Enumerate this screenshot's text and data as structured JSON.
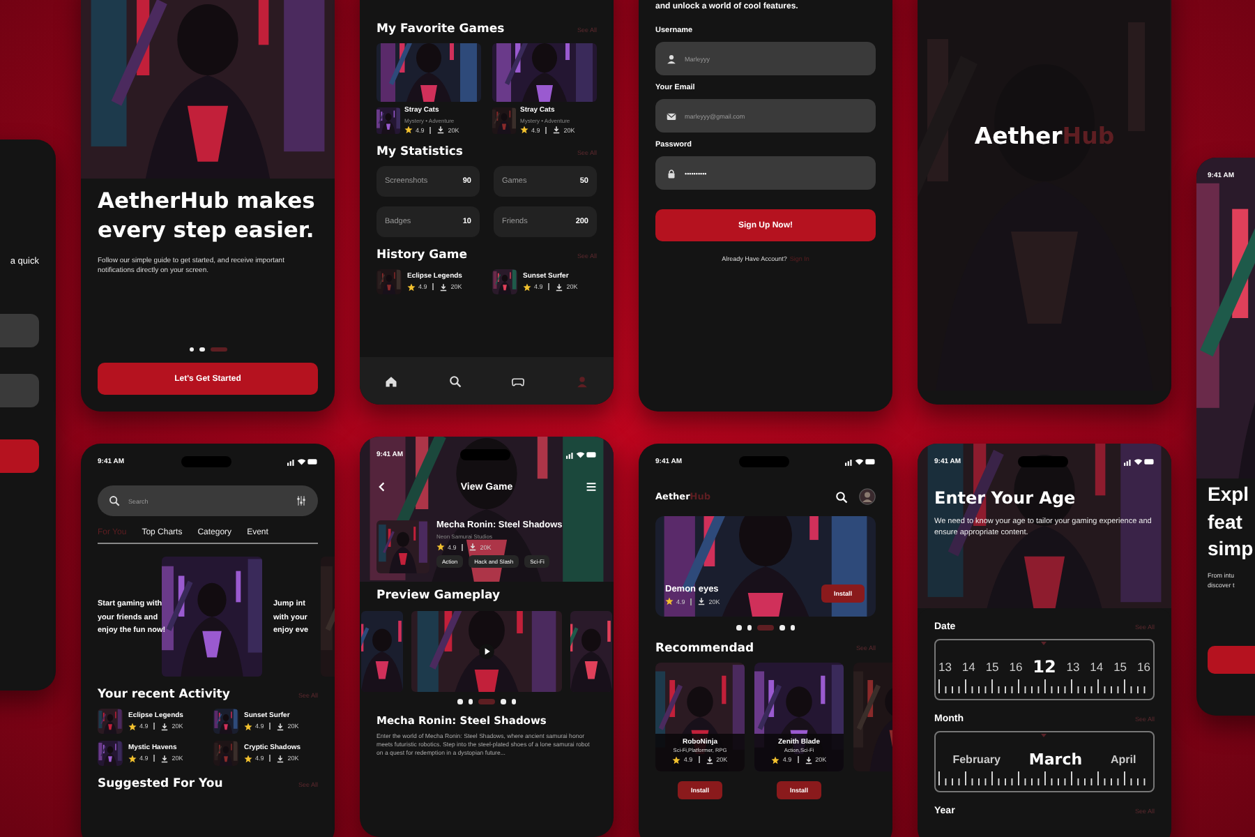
{
  "left_screen": {
    "heading": "a quick"
  },
  "onboarding": {
    "title": "AetherHub makes every step easier.",
    "body": "Follow our simple guide to get started, and receive important notifications directly on your screen.",
    "dots": [
      {
        "selected": false
      },
      {
        "selected": false
      },
      {
        "selected": true
      }
    ],
    "button": "Let's Get Started"
  },
  "home": {
    "favorites": {
      "title": "My Favorite Games",
      "see_all": "See All",
      "games": [
        {
          "name": "Stray Cats",
          "genre": "Mystery • Adventure",
          "rating": "4.9",
          "downloads": "20K"
        },
        {
          "name": "Stray Cats",
          "genre": "Mystery • Adventure",
          "rating": "4.9",
          "downloads": "20K"
        }
      ]
    },
    "statistics": {
      "title": "My Statistics",
      "see_all": "See All",
      "items": [
        {
          "label": "Screenshots",
          "value": "90"
        },
        {
          "label": "Games",
          "value": "50"
        },
        {
          "label": "Badges",
          "value": "10"
        },
        {
          "label": "Friends",
          "value": "200"
        }
      ]
    },
    "history": {
      "title": "History Game",
      "see_all": "See All",
      "games": [
        {
          "name": "Eclipse Legends",
          "rating": "4.9",
          "downloads": "20K"
        },
        {
          "name": "Sunset Surfer",
          "rating": "4.9",
          "downloads": "20K"
        }
      ]
    },
    "nav": [
      {
        "kind": "home",
        "selected": false
      },
      {
        "kind": "search",
        "selected": false
      },
      {
        "kind": "gamepad",
        "selected": false
      },
      {
        "kind": "profile",
        "selected": true
      }
    ]
  },
  "signup": {
    "intro": "and unlock a world of cool features.",
    "fields": [
      {
        "label": "Username",
        "kind": "user",
        "placeholder": "Marleyyy"
      },
      {
        "label": "Your Email",
        "kind": "mail",
        "placeholder": "marleyyy@gmail.com"
      },
      {
        "label": "Password",
        "kind": "lock",
        "value": "••••••••••"
      }
    ],
    "button": "Sign Up Now!",
    "prompt": "Already Have Account?",
    "link": "Sign In"
  },
  "splash": {
    "logo_main": "Aether",
    "logo_accent": "Hub"
  },
  "right_screen": {
    "time": "9:41 AM",
    "title_lines": [
      "Expl",
      "feat",
      "simp"
    ],
    "body_lines": [
      "From intu",
      "discover t"
    ]
  },
  "discover": {
    "time": "9:41 AM",
    "search": {
      "placeholder": "Search"
    },
    "tabs": [
      {
        "label": "For You",
        "selected": true
      },
      {
        "label": "Top Charts",
        "selected": false
      },
      {
        "label": "Category",
        "selected": false
      },
      {
        "label": "Event",
        "selected": false
      }
    ],
    "banners": [
      {
        "lines": [
          "Start gaming with",
          "your friends and",
          "enjoy the fun now!"
        ]
      },
      {
        "lines": [
          "Jump int",
          "with your",
          "enjoy eve"
        ]
      }
    ],
    "activity": {
      "title": "Your recent Activity",
      "see_all": "See All",
      "games": [
        {
          "name": "Eclipse Legends",
          "rating": "4.9",
          "downloads": "20K"
        },
        {
          "name": "Sunset Surfer",
          "rating": "4.9",
          "downloads": "20K"
        },
        {
          "name": "Mystic Havens",
          "rating": "4.9",
          "downloads": "20K"
        },
        {
          "name": "Cryptic Shadows",
          "rating": "4.9",
          "downloads": "20K"
        }
      ]
    },
    "suggested": {
      "title": "Suggested For You",
      "see_all": "See All"
    }
  },
  "view_game": {
    "time": "9:41 AM",
    "title": "View Game",
    "game": {
      "name": "Mecha Ronin: Steel Shadows",
      "studio": "Neon Samurai Studios",
      "rating": "4.9",
      "downloads": "20K",
      "tags": [
        "Action",
        "Hack and Slash",
        "Sci-Fi"
      ]
    },
    "preview_title": "Preview Gameplay",
    "dots": [
      {
        "selected": false
      },
      {
        "selected": false
      },
      {
        "selected": true
      },
      {
        "selected": false
      },
      {
        "selected": false
      }
    ],
    "about_title": "Mecha Ronin: Steel Shadows",
    "description": "Enter the world of Mecha Ronin: Steel Shadows, where ancient samurai honor meets futuristic robotics. Step into the steel-plated shoes of a lone samurai robot on a quest for redemption in a dystopian future..."
  },
  "home2": {
    "time": "9:41 AM",
    "logo_main": "Aether",
    "logo_accent": "Hub",
    "featured": {
      "name": "Demon eyes",
      "rating": "4.9",
      "downloads": "20K",
      "button": "Install"
    },
    "dots": [
      {
        "selected": false
      },
      {
        "selected": false
      },
      {
        "selected": true
      },
      {
        "selected": false
      },
      {
        "selected": false
      }
    ],
    "recommended": {
      "title": "Recommendad",
      "see_all": "See All",
      "games": [
        {
          "name": "RoboNinja",
          "genre": "Sci-Fi,Platformer, RPG",
          "rating": "4.9",
          "downloads": "20K",
          "button": "Install"
        },
        {
          "name": "Zenith Blade",
          "genre": "Action,Sci-Fi",
          "rating": "4.9",
          "downloads": "20K",
          "button": "Install"
        }
      ]
    }
  },
  "age": {
    "time": "9:41 AM",
    "title": "Enter Your Age",
    "body": "We need to know your age to tailor your gaming experience and ensure appropriate content.",
    "pickers": [
      {
        "label": "Date",
        "see_all": "See All",
        "options": [
          {
            "label": "13",
            "selected": false
          },
          {
            "label": "14",
            "selected": false
          },
          {
            "label": "15",
            "selected": false
          },
          {
            "label": "16",
            "selected": false
          },
          {
            "label": "12",
            "selected": true
          },
          {
            "label": "13",
            "selected": false
          },
          {
            "label": "14",
            "selected": false
          },
          {
            "label": "15",
            "selected": false
          },
          {
            "label": "16",
            "selected": false
          }
        ]
      },
      {
        "label": "Month",
        "see_all": "See All",
        "options": [
          {
            "label": "February",
            "selected": false
          },
          {
            "label": "March",
            "selected": true
          },
          {
            "label": "April",
            "selected": false
          }
        ]
      },
      {
        "label": "Year",
        "see_all": "See All"
      }
    ]
  }
}
